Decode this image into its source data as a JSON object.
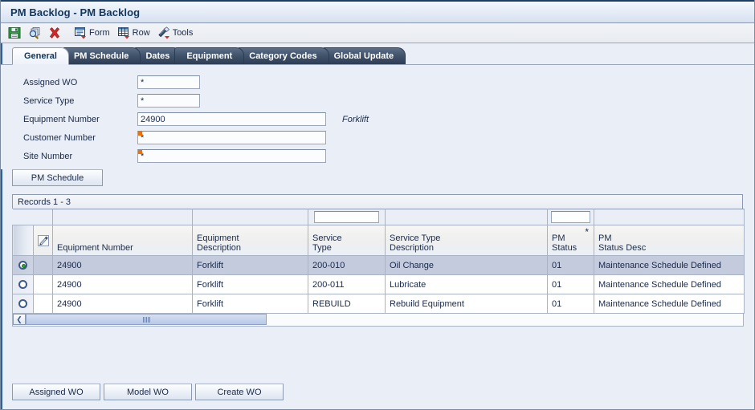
{
  "window": {
    "title": "PM Backlog - PM Backlog"
  },
  "toolbar": {
    "items": [
      {
        "icon": "save-icon",
        "label": ""
      },
      {
        "icon": "find-icon",
        "label": ""
      },
      {
        "icon": "delete-icon",
        "label": ""
      },
      {
        "icon": "form-icon",
        "label": "Form"
      },
      {
        "icon": "row-icon",
        "label": "Row"
      },
      {
        "icon": "tools-icon",
        "label": "Tools"
      }
    ]
  },
  "tabs": [
    {
      "label": "General",
      "active": true
    },
    {
      "label": "PM Schedule",
      "active": false
    },
    {
      "label": "Dates",
      "active": false
    },
    {
      "label": "Equipment",
      "active": false
    },
    {
      "label": "Category Codes",
      "active": false
    },
    {
      "label": "Global Update",
      "active": false
    }
  ],
  "form": {
    "fields": [
      {
        "label": "Assigned WO",
        "value": "*",
        "size": "small",
        "required": false,
        "side": ""
      },
      {
        "label": "Service Type",
        "value": "*",
        "size": "small",
        "required": false,
        "side": ""
      },
      {
        "label": "Equipment Number",
        "value": "24900",
        "size": "wide",
        "required": false,
        "side": "Forklift"
      },
      {
        "label": "Customer Number",
        "value": "*",
        "size": "wide",
        "required": true,
        "side": ""
      },
      {
        "label": "Site Number",
        "value": "*",
        "size": "wide",
        "required": true,
        "side": ""
      }
    ]
  },
  "grid": {
    "schedule_button": "PM Schedule",
    "records_label": "Records  1 - 3",
    "filters": [
      "",
      "",
      "",
      "",
      "",
      "",
      "",
      ""
    ],
    "columns": [
      {
        "line1": "",
        "line2": "",
        "star": false
      },
      {
        "line1": "",
        "line2": "",
        "star": false
      },
      {
        "line1": "",
        "line2": "Equipment Number",
        "star": false
      },
      {
        "line1": "Equipment",
        "line2": "Description",
        "star": false
      },
      {
        "line1": "Service",
        "line2": "Type",
        "star": false
      },
      {
        "line1": "Service Type",
        "line2": "Description",
        "star": false
      },
      {
        "line1": "PM",
        "line2": "Status",
        "star": true
      },
      {
        "line1": "PM",
        "line2": "Status Desc",
        "star": false
      }
    ],
    "rows": [
      {
        "selected": true,
        "equipment_number": "24900",
        "equipment_description": "Forklift",
        "service_type": "200-010",
        "service_type_description": "Oil Change",
        "pm_status": "01",
        "pm_status_desc": "Maintenance Schedule Defined"
      },
      {
        "selected": false,
        "equipment_number": "24900",
        "equipment_description": "Forklift",
        "service_type": "200-011",
        "service_type_description": "Lubricate",
        "pm_status": "01",
        "pm_status_desc": "Maintenance Schedule Defined"
      },
      {
        "selected": false,
        "equipment_number": "24900",
        "equipment_description": "Forklift",
        "service_type": "REBUILD",
        "service_type_description": "Rebuild Equipment",
        "pm_status": "01",
        "pm_status_desc": "Maintenance Schedule Defined"
      }
    ]
  },
  "footer": {
    "buttons": [
      {
        "label": "Assigned WO"
      },
      {
        "label": "Model WO"
      },
      {
        "label": "Create WO"
      }
    ]
  },
  "colors": {
    "accent": "#12375e",
    "tab_active_text": "#12375e",
    "tab_inactive_bg": "#2c3d55",
    "selection_row": "#c3cbdd",
    "required_marker": "#e8730e",
    "panel_bg": "#eaeff7"
  }
}
